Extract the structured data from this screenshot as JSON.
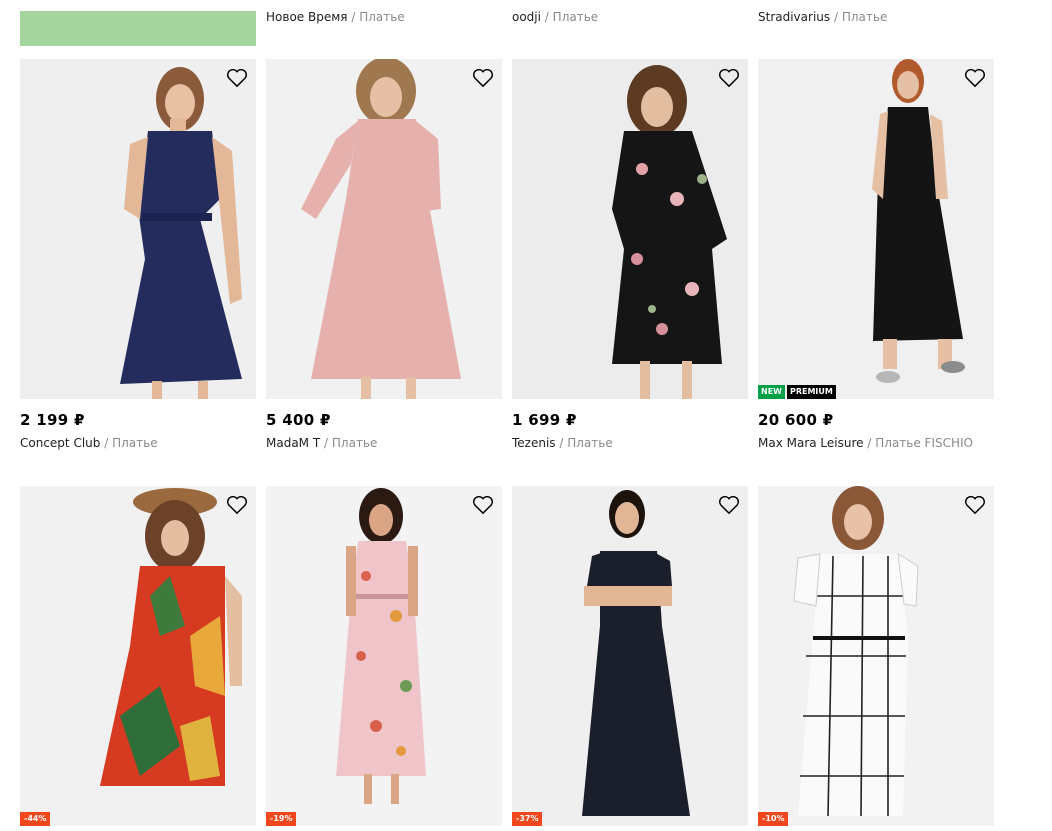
{
  "top_row": {
    "items": [
      {
        "brand": "Новое Время",
        "category": "Платье"
      },
      {
        "brand": "oodji",
        "category": "Платье"
      },
      {
        "brand": "Stradivarius",
        "category": "Платье"
      }
    ]
  },
  "separator": "/",
  "products": [
    {
      "price": "2 199 ₽",
      "brand": "Concept Club",
      "category": "Платье",
      "image_icon": "navy-dress-image"
    },
    {
      "price": "5 400 ₽",
      "brand": "MadaM T",
      "category": "Платье",
      "image_icon": "pink-dress-image"
    },
    {
      "price": "1 699 ₽",
      "brand": "Tezenis",
      "category": "Платье",
      "image_icon": "black-floral-dress-image"
    },
    {
      "price": "20 600 ₽",
      "brand": "Max Mara Leisure",
      "category": "Платье FISCHIO",
      "badges": [
        "NEW",
        "PREMIUM"
      ],
      "image_icon": "black-maxi-dress-image"
    },
    {
      "discount": "-44%",
      "image_icon": "red-tropical-dress-image"
    },
    {
      "discount": "-19%",
      "image_icon": "pink-floral-maxi-dress-image"
    },
    {
      "discount": "-37%",
      "image_icon": "black-long-dress-image"
    },
    {
      "discount": "-10%",
      "image_icon": "white-check-shirt-dress-image"
    }
  ],
  "colors": {
    "badge_new": "#00a046",
    "badge_premium": "#000000",
    "discount": "#f0471c",
    "category_text": "#8a8a8a",
    "top_bar": "#a5d59f"
  }
}
